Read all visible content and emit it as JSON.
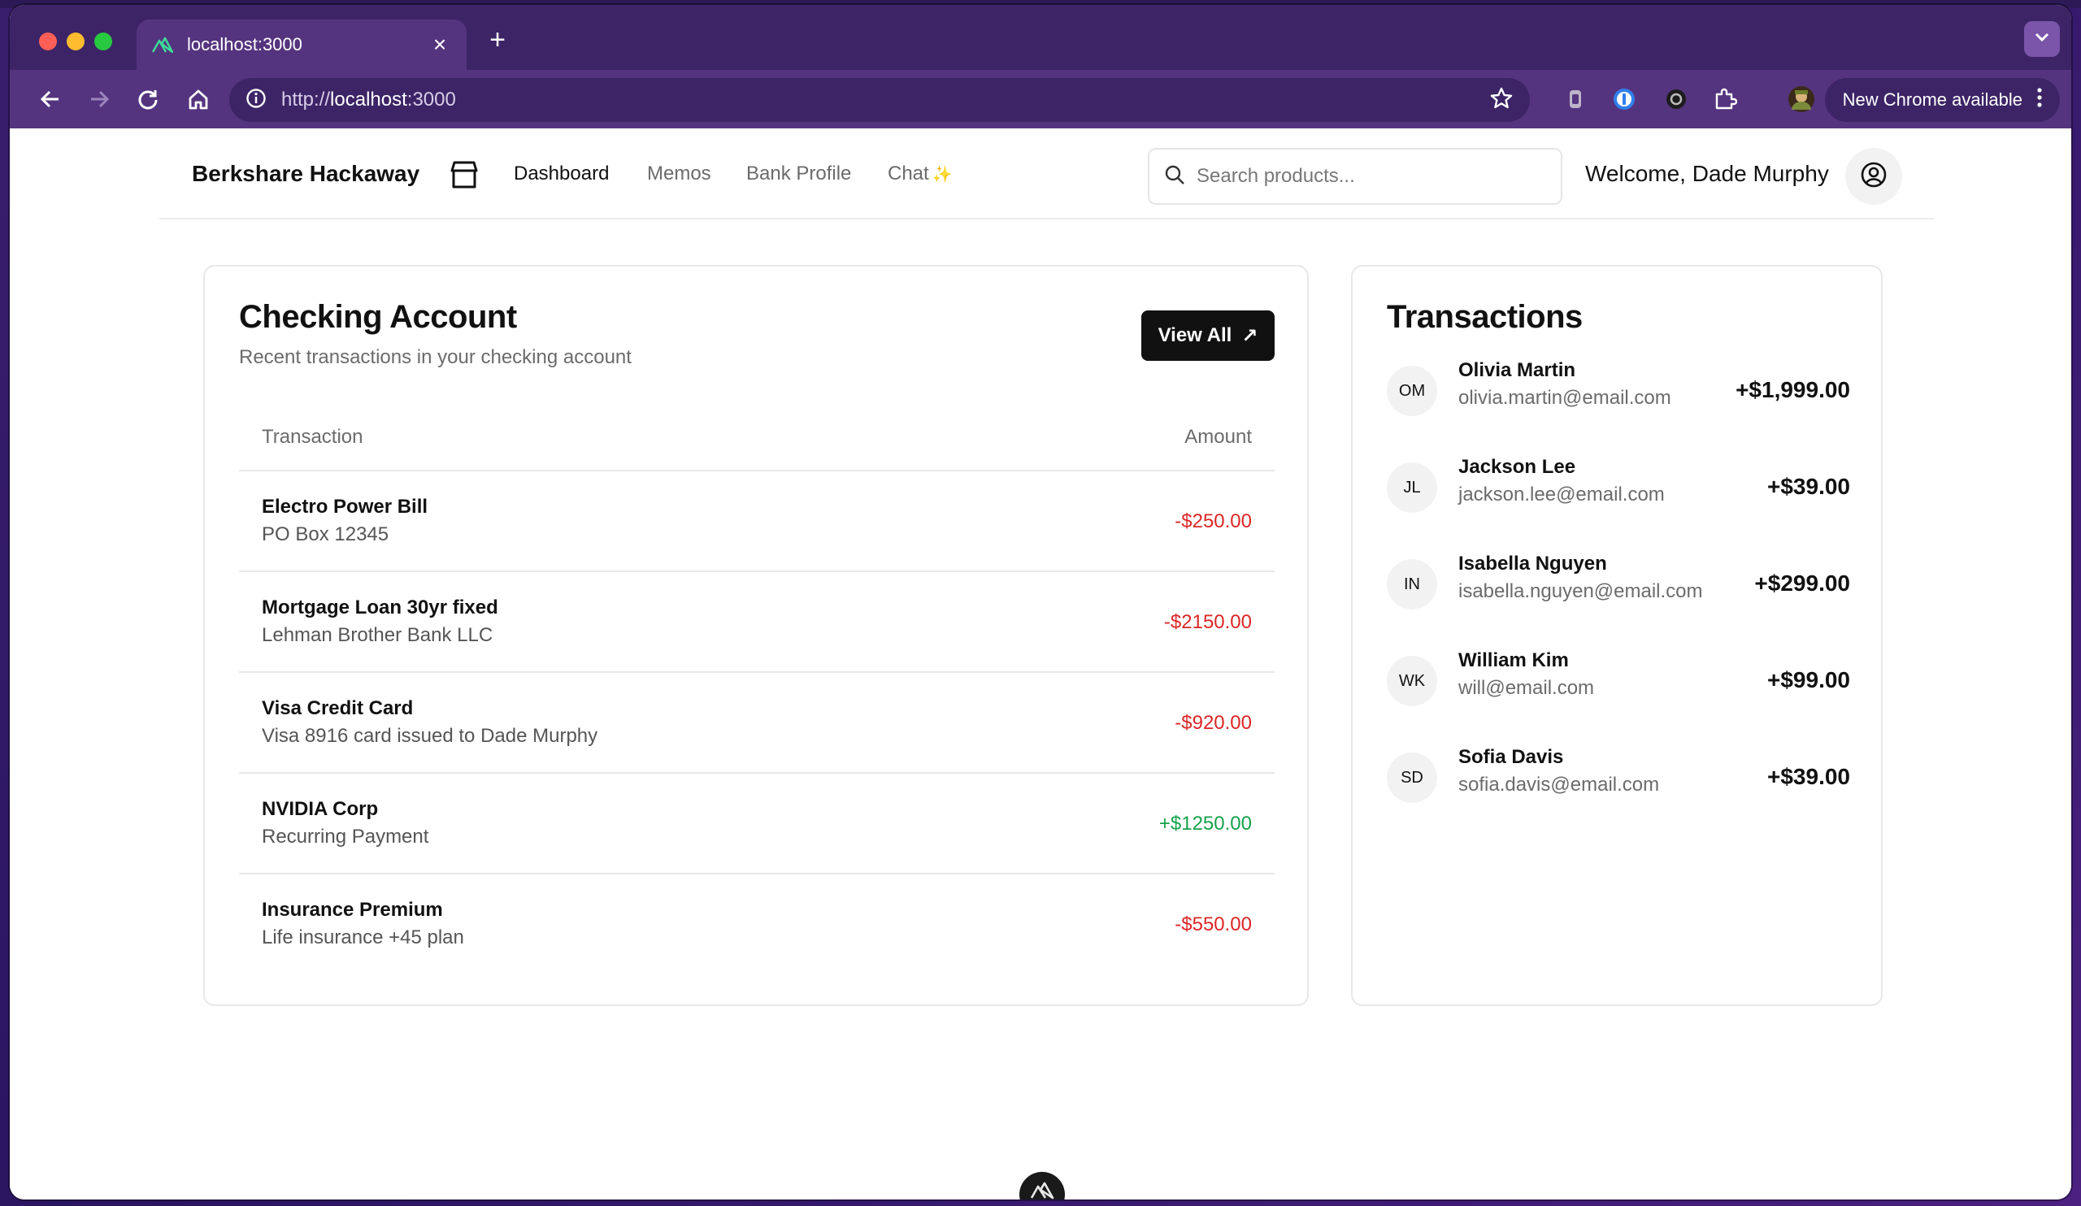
{
  "browser": {
    "tab": {
      "title": "localhost:3000",
      "close_glyph": "×"
    },
    "new_tab_glyph": "+",
    "omnibox": {
      "scheme": "http://",
      "host": "localhost",
      "port": ":3000"
    },
    "update_label": "New Chrome available"
  },
  "header": {
    "brand": "Berkshare Hackaway",
    "nav": {
      "dashboard": "Dashboard",
      "memos": "Memos",
      "bank_profile": "Bank Profile",
      "chat": "Chat",
      "chat_sparkle": "✨"
    },
    "search_placeholder": "Search products...",
    "welcome": "Welcome, Dade Murphy"
  },
  "checking": {
    "title": "Checking Account",
    "subtitle": "Recent transactions in your checking account",
    "view_all": "View All",
    "view_all_arrow": "↗",
    "columns": {
      "transaction": "Transaction",
      "amount": "Amount"
    },
    "rows": [
      {
        "name": "Electro Power Bill",
        "desc": "PO Box 12345",
        "amount": "-$250.00",
        "sign": "neg"
      },
      {
        "name": "Mortgage Loan 30yr fixed",
        "desc": "Lehman Brother Bank LLC",
        "amount": "-$2150.00",
        "sign": "neg"
      },
      {
        "name": "Visa Credit Card",
        "desc": "Visa 8916 card issued to Dade Murphy",
        "amount": "-$920.00",
        "sign": "neg"
      },
      {
        "name": "NVIDIA Corp",
        "desc": "Recurring Payment",
        "amount": "+$1250.00",
        "sign": "pos"
      },
      {
        "name": "Insurance Premium",
        "desc": "Life insurance +45 plan",
        "amount": "-$550.00",
        "sign": "neg"
      }
    ]
  },
  "transactions": {
    "title": "Transactions",
    "items": [
      {
        "initials": "OM",
        "name": "Olivia Martin",
        "email": "olivia.martin@email.com",
        "amount": "+$1,999.00"
      },
      {
        "initials": "JL",
        "name": "Jackson Lee",
        "email": "jackson.lee@email.com",
        "amount": "+$39.00"
      },
      {
        "initials": "IN",
        "name": "Isabella Nguyen",
        "email": "isabella.nguyen@email.com",
        "amount": "+$299.00"
      },
      {
        "initials": "WK",
        "name": "William Kim",
        "email": "will@email.com",
        "amount": "+$99.00"
      },
      {
        "initials": "SD",
        "name": "Sofia Davis",
        "email": "sofia.davis@email.com",
        "amount": "+$39.00"
      }
    ]
  },
  "colors": {
    "negative": "#dc2626",
    "positive": "#16a34a",
    "chrome_frame": "#55347f",
    "button_dark": "#111111"
  }
}
